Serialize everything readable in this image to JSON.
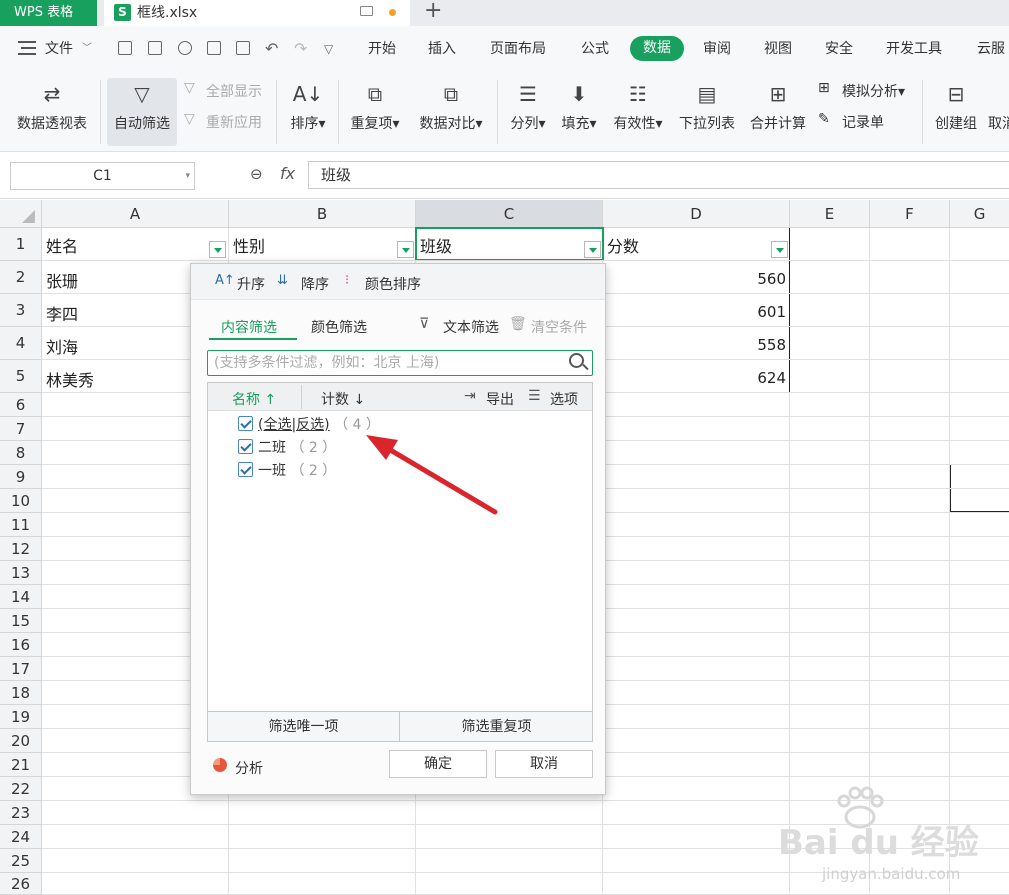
{
  "tabbar": {
    "app_tab": "WPS 表格",
    "file_icon": "S",
    "file_name": "框线.xlsx",
    "plus": "+"
  },
  "menubar": {
    "file_label": "文件",
    "items": [
      "开始",
      "插入",
      "页面布局",
      "公式",
      "数据",
      "审阅",
      "视图",
      "安全",
      "开发工具",
      "云服"
    ],
    "active": "数据"
  },
  "ribbon": {
    "pivot": "数据透视表",
    "autofilter": "自动筛选",
    "show_all": "全部显示",
    "reapply": "重新应用",
    "sort": "排序",
    "duplicates": "重复项",
    "compare": "数据对比",
    "split": "分列",
    "fill": "填充",
    "validity": "有效性",
    "dropdown_list": "下拉列表",
    "consolidate": "合并计算",
    "simulate": "模拟分析",
    "record": "记录单",
    "create_group": "创建组",
    "cancel_group": "取消"
  },
  "formula": {
    "cell_ref": "C1",
    "fx": "fx",
    "content": "班级"
  },
  "grid": {
    "columns": [
      "A",
      "B",
      "C",
      "D",
      "E",
      "F",
      "G"
    ],
    "rows": [
      "1",
      "2",
      "3",
      "4",
      "5",
      "6",
      "7",
      "8",
      "9",
      "10",
      "11",
      "12",
      "13",
      "14",
      "15",
      "16",
      "17",
      "18",
      "19",
      "20",
      "21",
      "22",
      "23",
      "24",
      "25",
      "26"
    ],
    "headers": [
      "姓名",
      "性别",
      "班级",
      "分数"
    ],
    "names": [
      "张珊",
      "李四",
      "刘海",
      "林美秀"
    ],
    "scores": [
      "560",
      "601",
      "558",
      "624"
    ]
  },
  "filter": {
    "asc": "升序",
    "desc": "降序",
    "color_sort": "颜色排序",
    "content_tab": "内容筛选",
    "color_tab": "颜色筛选",
    "text_filter": "文本筛选",
    "clear": "清空条件",
    "search_placeholder": "(支持多条件过滤，例如：北京 上海)",
    "col_name": "名称",
    "col_count": "计数",
    "export": "导出",
    "options": "选项",
    "items": [
      {
        "label": "(全选|反选)",
        "count": "（ 4 ）"
      },
      {
        "label": "二班",
        "count": "（ 2 ）"
      },
      {
        "label": "一班",
        "count": "（ 2 ）"
      }
    ],
    "unique": "筛选唯一项",
    "dupes": "筛选重复项",
    "analyze": "分析",
    "ok": "确定",
    "cancel": "取消"
  },
  "watermark": {
    "brand": "Bai du 经验",
    "url": "jingyan.baidu.com"
  },
  "colors": {
    "accent": "#18a05e",
    "arrow": "#d9252b"
  }
}
